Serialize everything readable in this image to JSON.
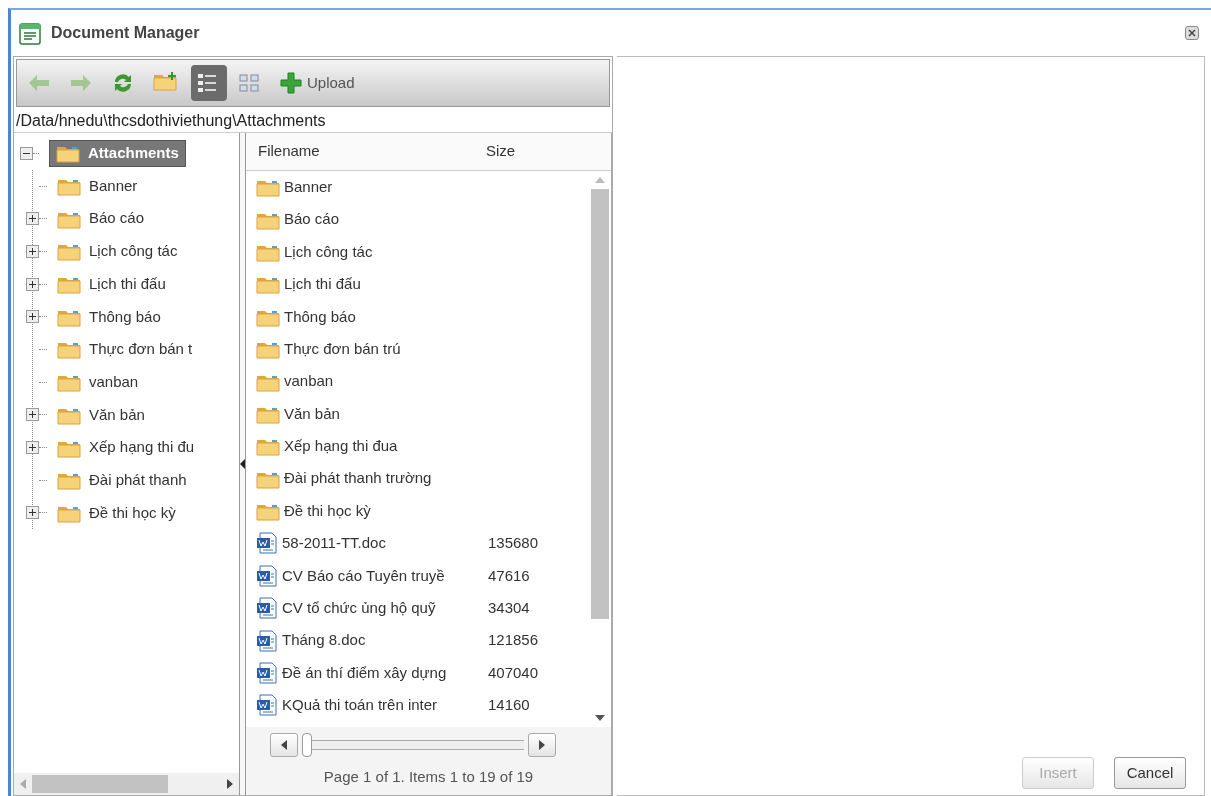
{
  "window": {
    "title": "Document Manager"
  },
  "toolbar": [
    {
      "kind": "back",
      "disabled": true
    },
    {
      "kind": "forward",
      "disabled": true
    },
    {
      "kind": "refresh",
      "disabled": false
    },
    {
      "kind": "new-folder",
      "disabled": false
    },
    {
      "kind": "details-view",
      "selected": true
    },
    {
      "kind": "thumbnails-view",
      "selected": false
    },
    {
      "kind": "upload",
      "label": "Upload",
      "disabled": false
    }
  ],
  "path": "/Data/hnedu\\thcsdothiviethung\\Attachments",
  "tree": {
    "label": "Attachments",
    "expanded": true,
    "selected": true,
    "children": [
      {
        "label": "Banner",
        "expandable": false
      },
      {
        "label": "Báo cáo",
        "expandable": true
      },
      {
        "label": "Lịch công tác",
        "expandable": true
      },
      {
        "label": "Lịch thi đấu",
        "expandable": true
      },
      {
        "label": "Thông báo",
        "expandable": true
      },
      {
        "label": "Thực đơn bán t",
        "expandable": false
      },
      {
        "label": "vanban",
        "expandable": false
      },
      {
        "label": "Văn bản",
        "expandable": true
      },
      {
        "label": "Xếp hạng thi đu",
        "expandable": true
      },
      {
        "label": "Đài phát thanh",
        "expandable": false
      },
      {
        "label": "Đề thi học kỳ",
        "expandable": true
      }
    ]
  },
  "file_list": {
    "columns": [
      "Filename",
      "Size"
    ],
    "rows": [
      {
        "kind": "folder",
        "name": "Banner"
      },
      {
        "kind": "folder",
        "name": "Báo cáo"
      },
      {
        "kind": "folder",
        "name": "Lịch công tác"
      },
      {
        "kind": "folder",
        "name": "Lịch thi đấu"
      },
      {
        "kind": "folder",
        "name": "Thông báo"
      },
      {
        "kind": "folder",
        "name": "Thực đơn bán trú"
      },
      {
        "kind": "folder",
        "name": "vanban"
      },
      {
        "kind": "folder",
        "name": "Văn bản"
      },
      {
        "kind": "folder",
        "name": "Xếp hạng thi đua"
      },
      {
        "kind": "folder",
        "name": "Đài phát thanh trường"
      },
      {
        "kind": "folder",
        "name": "Đề thi học kỳ"
      },
      {
        "kind": "document",
        "name": "58-2011-TT.doc",
        "size": "135680"
      },
      {
        "kind": "document",
        "name": "CV Báo cáo Tuyên truyề",
        "size": "47616"
      },
      {
        "kind": "document",
        "name": "CV tổ chức ủng hộ quỹ",
        "size": "34304"
      },
      {
        "kind": "document",
        "name": "Tháng 8.doc",
        "size": "121856"
      },
      {
        "kind": "document",
        "name": "Đề án thí điểm xây dựng",
        "size": "407040"
      },
      {
        "kind": "document",
        "name": "KQuả thi toán trên inter",
        "size": "14160"
      }
    ],
    "pager_slider": {
      "level": 0
    },
    "pager_text": "Page 1 of 1. Items 1 to 19 of 19"
  },
  "buttons": [
    {
      "label": "Insert",
      "disabled": true
    },
    {
      "label": "Cancel",
      "disabled": false
    }
  ]
}
